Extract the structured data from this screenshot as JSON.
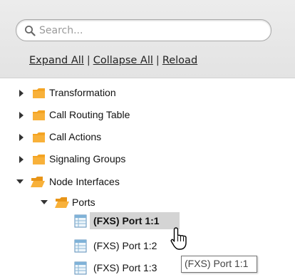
{
  "search": {
    "placeholder": "Search..."
  },
  "actions": {
    "expand_all": "Expand All",
    "separator": "|",
    "collapse_all": "Collapse All",
    "reload": "Reload"
  },
  "tree": {
    "items": [
      {
        "label": "Transformation",
        "state": "collapsed"
      },
      {
        "label": "Call Routing Table",
        "state": "collapsed"
      },
      {
        "label": "Call Actions",
        "state": "collapsed"
      },
      {
        "label": "Signaling Groups",
        "state": "collapsed"
      },
      {
        "label": "Node Interfaces",
        "state": "expanded"
      },
      {
        "label": "Ports",
        "state": "expanded"
      }
    ],
    "ports": [
      {
        "label": "(FXS) Port 1:1",
        "selected": true
      },
      {
        "label": "(FXS) Port 1:2",
        "selected": false
      },
      {
        "label": "(FXS) Port 1:3",
        "selected": false
      }
    ]
  },
  "tooltip": {
    "text": "(FXS) Port 1:1"
  },
  "icons": {
    "expand_arrow": "triangle-right-icon",
    "collapse_arrow": "triangle-down-icon",
    "folder": "folder-icon",
    "folder_open": "folder-open-icon",
    "port": "table-icon",
    "cursor": "hand-pointer-icon"
  },
  "colors": {
    "folder": "#f2a024",
    "selection": "#d4d4d4",
    "panel": "#e8e8e8"
  }
}
